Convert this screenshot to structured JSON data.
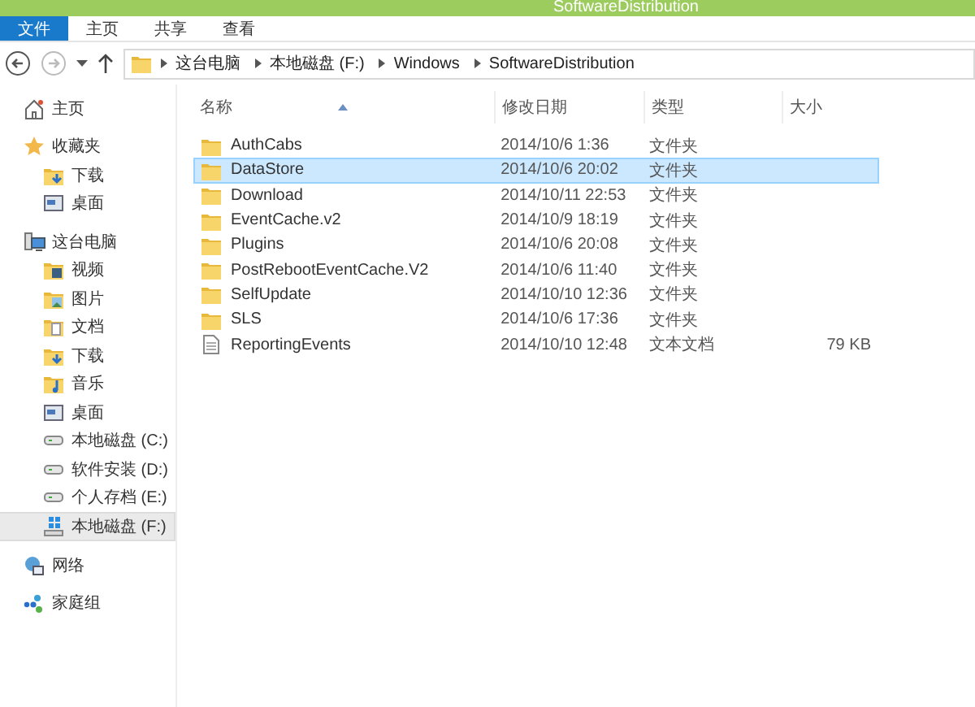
{
  "window": {
    "title": "SoftwareDistribution"
  },
  "ribbon_tabs": [
    {
      "label": "文件",
      "selected": true
    },
    {
      "label": "主页",
      "selected": false
    },
    {
      "label": "共享",
      "selected": false
    },
    {
      "label": "查看",
      "selected": false
    }
  ],
  "address_bar": {
    "path": [
      "这台电脑",
      "本地磁盘 (F:)",
      "Windows",
      "SoftwareDistribution"
    ]
  },
  "sidebar": {
    "items": [
      {
        "label": "主页",
        "kind": "home",
        "selected": false
      },
      {
        "label": "收藏夹",
        "kind": "star",
        "selected": false,
        "children": [
          {
            "label": "下载",
            "kind": "download",
            "selected": false
          },
          {
            "label": "桌面",
            "kind": "desktop",
            "selected": false
          }
        ]
      },
      {
        "label": "这台电脑",
        "kind": "pc",
        "selected": false,
        "children": [
          {
            "label": "视频",
            "kind": "video",
            "selected": false
          },
          {
            "label": "图片",
            "kind": "picture",
            "selected": false
          },
          {
            "label": "文档",
            "kind": "document",
            "selected": false
          },
          {
            "label": "下载",
            "kind": "download",
            "selected": false
          },
          {
            "label": "音乐",
            "kind": "music",
            "selected": false
          },
          {
            "label": "桌面",
            "kind": "desktop",
            "selected": false
          },
          {
            "label": "本地磁盘 (C:)",
            "kind": "drive",
            "selected": false
          },
          {
            "label": "软件安装 (D:)",
            "kind": "drive",
            "selected": false
          },
          {
            "label": "个人存档 (E:)",
            "kind": "drive",
            "selected": false
          },
          {
            "label": "本地磁盘 (F:)",
            "kind": "windrive",
            "selected": true
          }
        ]
      },
      {
        "label": "网络",
        "kind": "network",
        "selected": false
      },
      {
        "label": "家庭组",
        "kind": "homegroup",
        "selected": false
      }
    ]
  },
  "table": {
    "columns": [
      "名称",
      "修改日期",
      "类型",
      "大小"
    ],
    "rows": [
      {
        "kind": "folder",
        "name": "AuthCabs",
        "date": "2014/10/6 1:36",
        "type": "文件夹",
        "selected": false
      },
      {
        "kind": "folder",
        "name": "DataStore",
        "date": "2014/10/6 20:02",
        "type": "文件夹",
        "selected": true
      },
      {
        "kind": "folder",
        "name": "Download",
        "date": "2014/10/11 22:53",
        "type": "文件夹",
        "selected": false
      },
      {
        "kind": "folder",
        "name": "EventCache.v2",
        "date": "2014/10/9 18:19",
        "type": "文件夹",
        "selected": false
      },
      {
        "kind": "folder",
        "name": "Plugins",
        "date": "2014/10/6 20:08",
        "type": "文件夹",
        "selected": false
      },
      {
        "kind": "folder",
        "name": "PostRebootEventCache.V2",
        "date": "2014/10/6 11:40",
        "type": "文件夹",
        "selected": false
      },
      {
        "kind": "folder",
        "name": "SelfUpdate",
        "date": "2014/10/10 12:36",
        "type": "文件夹",
        "selected": false
      },
      {
        "kind": "folder",
        "name": "SLS",
        "date": "2014/10/6 17:36",
        "type": "文件夹",
        "selected": false
      },
      {
        "kind": "file",
        "name": "ReportingEvents",
        "date": "2014/10/10 12:48",
        "type": "文本文档",
        "size": "79 KB",
        "selected": false
      }
    ]
  }
}
